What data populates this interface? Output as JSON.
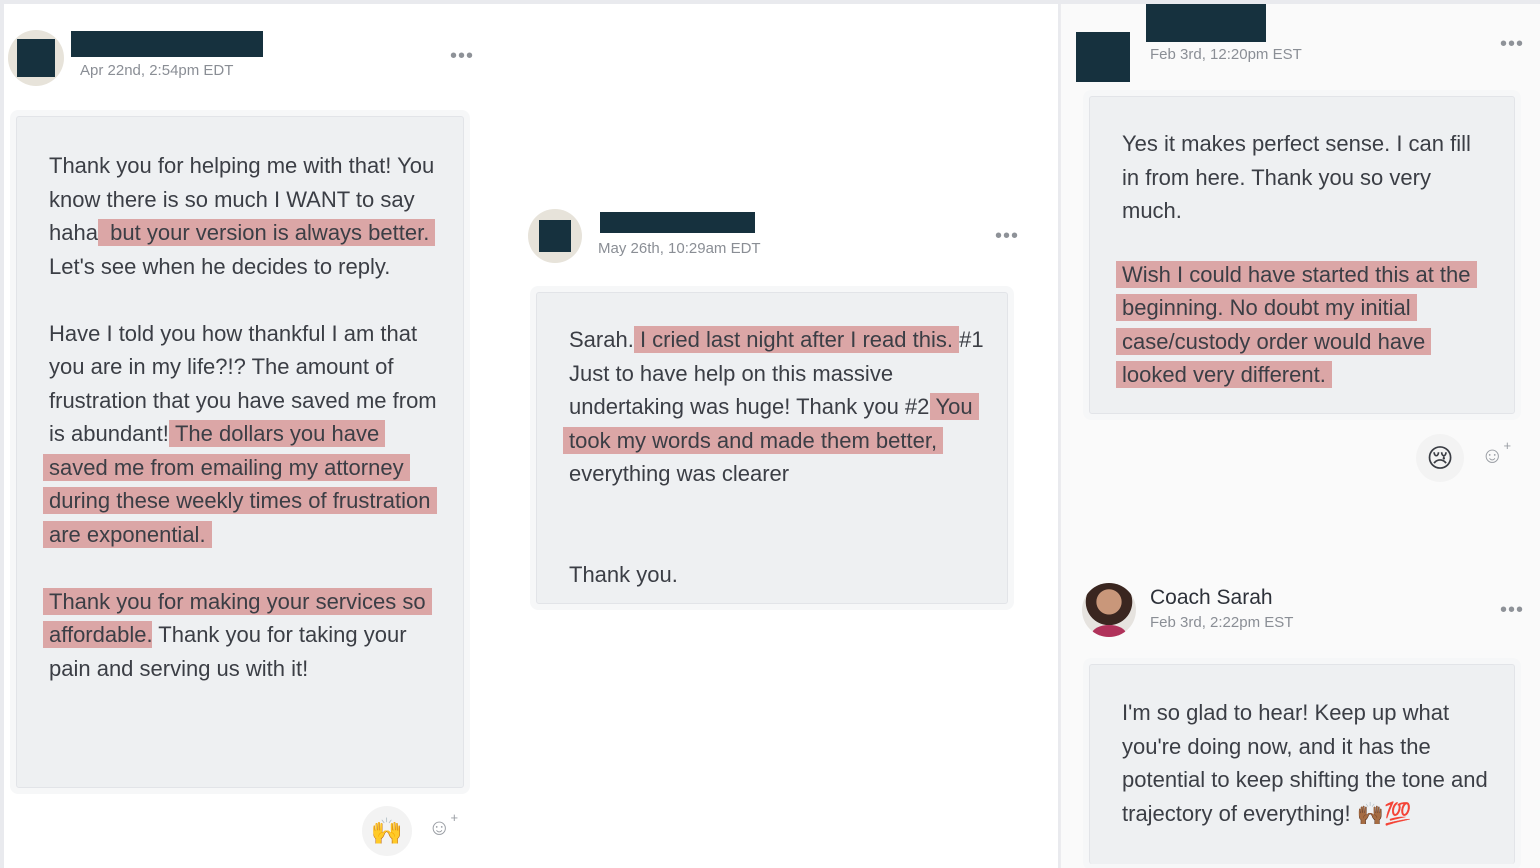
{
  "left_post": {
    "timestamp": "Apr 22nd, 2:54pm EDT",
    "menu_icon": "more-horizontal-icon",
    "paragraphs": [
      [
        {
          "text": "Thank you for helping me with that! You know there is so much I WANT to say haha,",
          "highlight": false
        },
        {
          "text": " but your version is always better.",
          "highlight": true
        },
        {
          "text": " Let's see when he decides to reply.",
          "highlight": false
        }
      ],
      [
        {
          "text": "Have I told you how thankful I am that you are in my life?!? The amount of frustration that you have saved me from is abundant! ",
          "highlight": false
        },
        {
          "text": "The dollars you have saved me from emailing my attorney during these weekly times of frustration are exponential.",
          "highlight": true
        }
      ],
      [
        {
          "text": "Thank you for making your services so affordable",
          "highlight": true
        },
        {
          "text": ". Thank you for taking your pain and serving us with it!",
          "highlight": false
        }
      ]
    ],
    "reaction_emoji": "🙌",
    "add_reaction_icon": "add-emoji-icon"
  },
  "middle_post": {
    "timestamp": "May 26th, 10:29am EDT",
    "menu_icon": "more-horizontal-icon",
    "paragraphs": [
      [
        {
          "text": "Sarah. ",
          "highlight": false
        },
        {
          "text": "I cried last night after I read this.",
          "highlight": true
        },
        {
          "text": " #1 Just to have help on this massive undertaking was huge! Thank you #2 ",
          "highlight": false
        },
        {
          "text": "You took my words and made them better,",
          "highlight": true
        },
        {
          "text": " everything was clearer",
          "highlight": false
        }
      ],
      [
        {
          "text": "Thank you.",
          "highlight": false
        }
      ]
    ]
  },
  "right_post": {
    "timestamp": "Feb 3rd, 12:20pm EST",
    "menu_icon": "more-horizontal-icon",
    "paragraphs": [
      [
        {
          "text": "Yes it makes perfect sense. I can fill in from here. Thank you so very much.",
          "highlight": false
        }
      ],
      [
        {
          "text": "Wish I could have started this at the beginning. No doubt my initial case/custody order would have looked very different.",
          "highlight": true
        }
      ]
    ],
    "reaction_emoji": "😢",
    "add_reaction_icon": "add-emoji-icon"
  },
  "coach_reply": {
    "name": "Coach Sarah",
    "timestamp": "Feb 3rd, 2:22pm EST",
    "menu_icon": "more-horizontal-icon",
    "paragraphs": [
      [
        {
          "text": "I'm so glad to hear! Keep up what you're doing now, and it has the potential to keep shifting the tone and trajectory of everything! 🙌🏾💯",
          "highlight": false
        }
      ]
    ]
  },
  "colors": {
    "highlight": "#dba6a6",
    "redaction": "#16313e",
    "card_bg": "#eef0f2"
  }
}
